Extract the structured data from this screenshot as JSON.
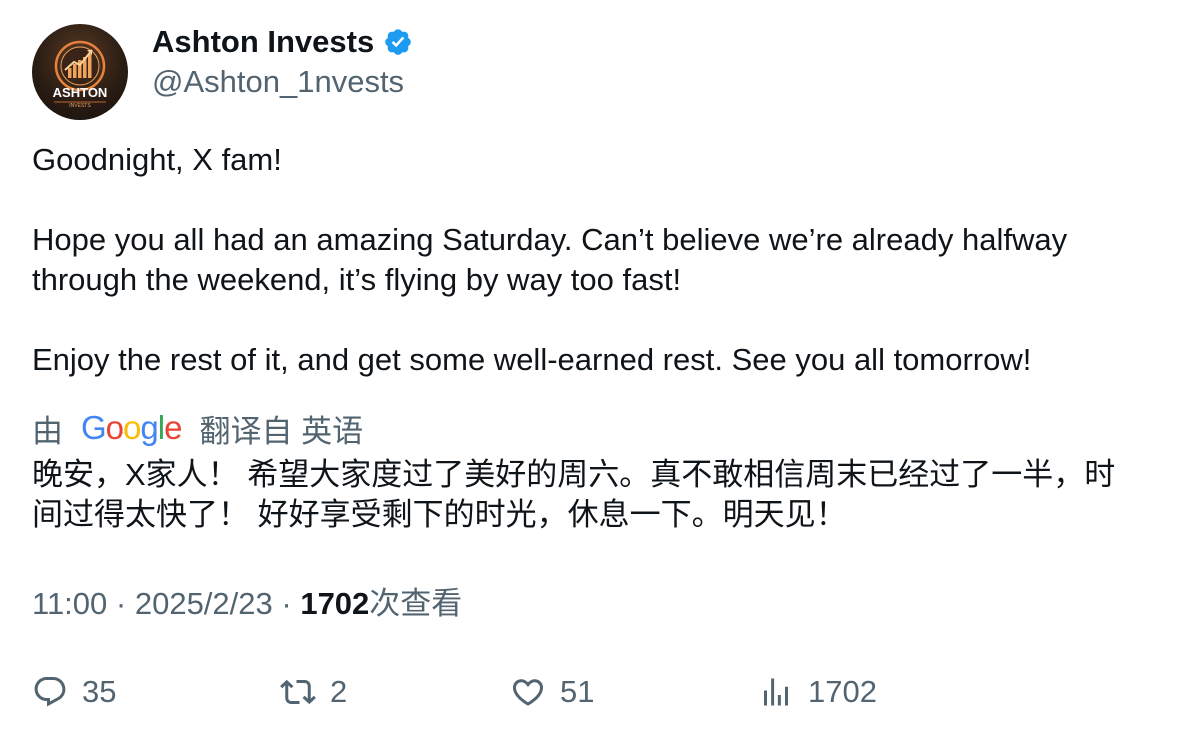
{
  "author": {
    "display_name": "Ashton Invests",
    "handle": "@Ashton_1nvests",
    "verified": true,
    "avatar": {
      "brand_text": "ASHTON",
      "sub_text": "INVESTS",
      "icon": "bar-chart-growth-logo"
    }
  },
  "tweet": {
    "lines": [
      "Goodnight, X fam!",
      "",
      "Hope you all had an amazing Saturday. Can’t believe we’re already halfway",
      "through the weekend, it’s flying by way too fast!",
      "",
      "Enjoy the rest of it, and get some well-earned rest. See you all tomorrow!"
    ]
  },
  "translation": {
    "prefix": "由",
    "provider": "Google",
    "suffix": "翻译自 英语",
    "lines": [
      "晚安，X家人！ 希望大家度过了美好的周六。真不敢相信周末已经过了一半，时",
      "间过得太快了！ 好好享受剩下的时光，休息一下。明天见！"
    ]
  },
  "meta": {
    "time": "11:00",
    "separator": " · ",
    "date": "2025/2/23",
    "views_count": "1702",
    "views_label": "次查看"
  },
  "actions": {
    "replies": "35",
    "retweets": "2",
    "likes": "51",
    "views": "1702"
  },
  "colors": {
    "text_primary": "#0f1419",
    "text_secondary": "#536471",
    "verified_blue": "#1d9bf0",
    "avatar_accent": "#e8823a"
  }
}
